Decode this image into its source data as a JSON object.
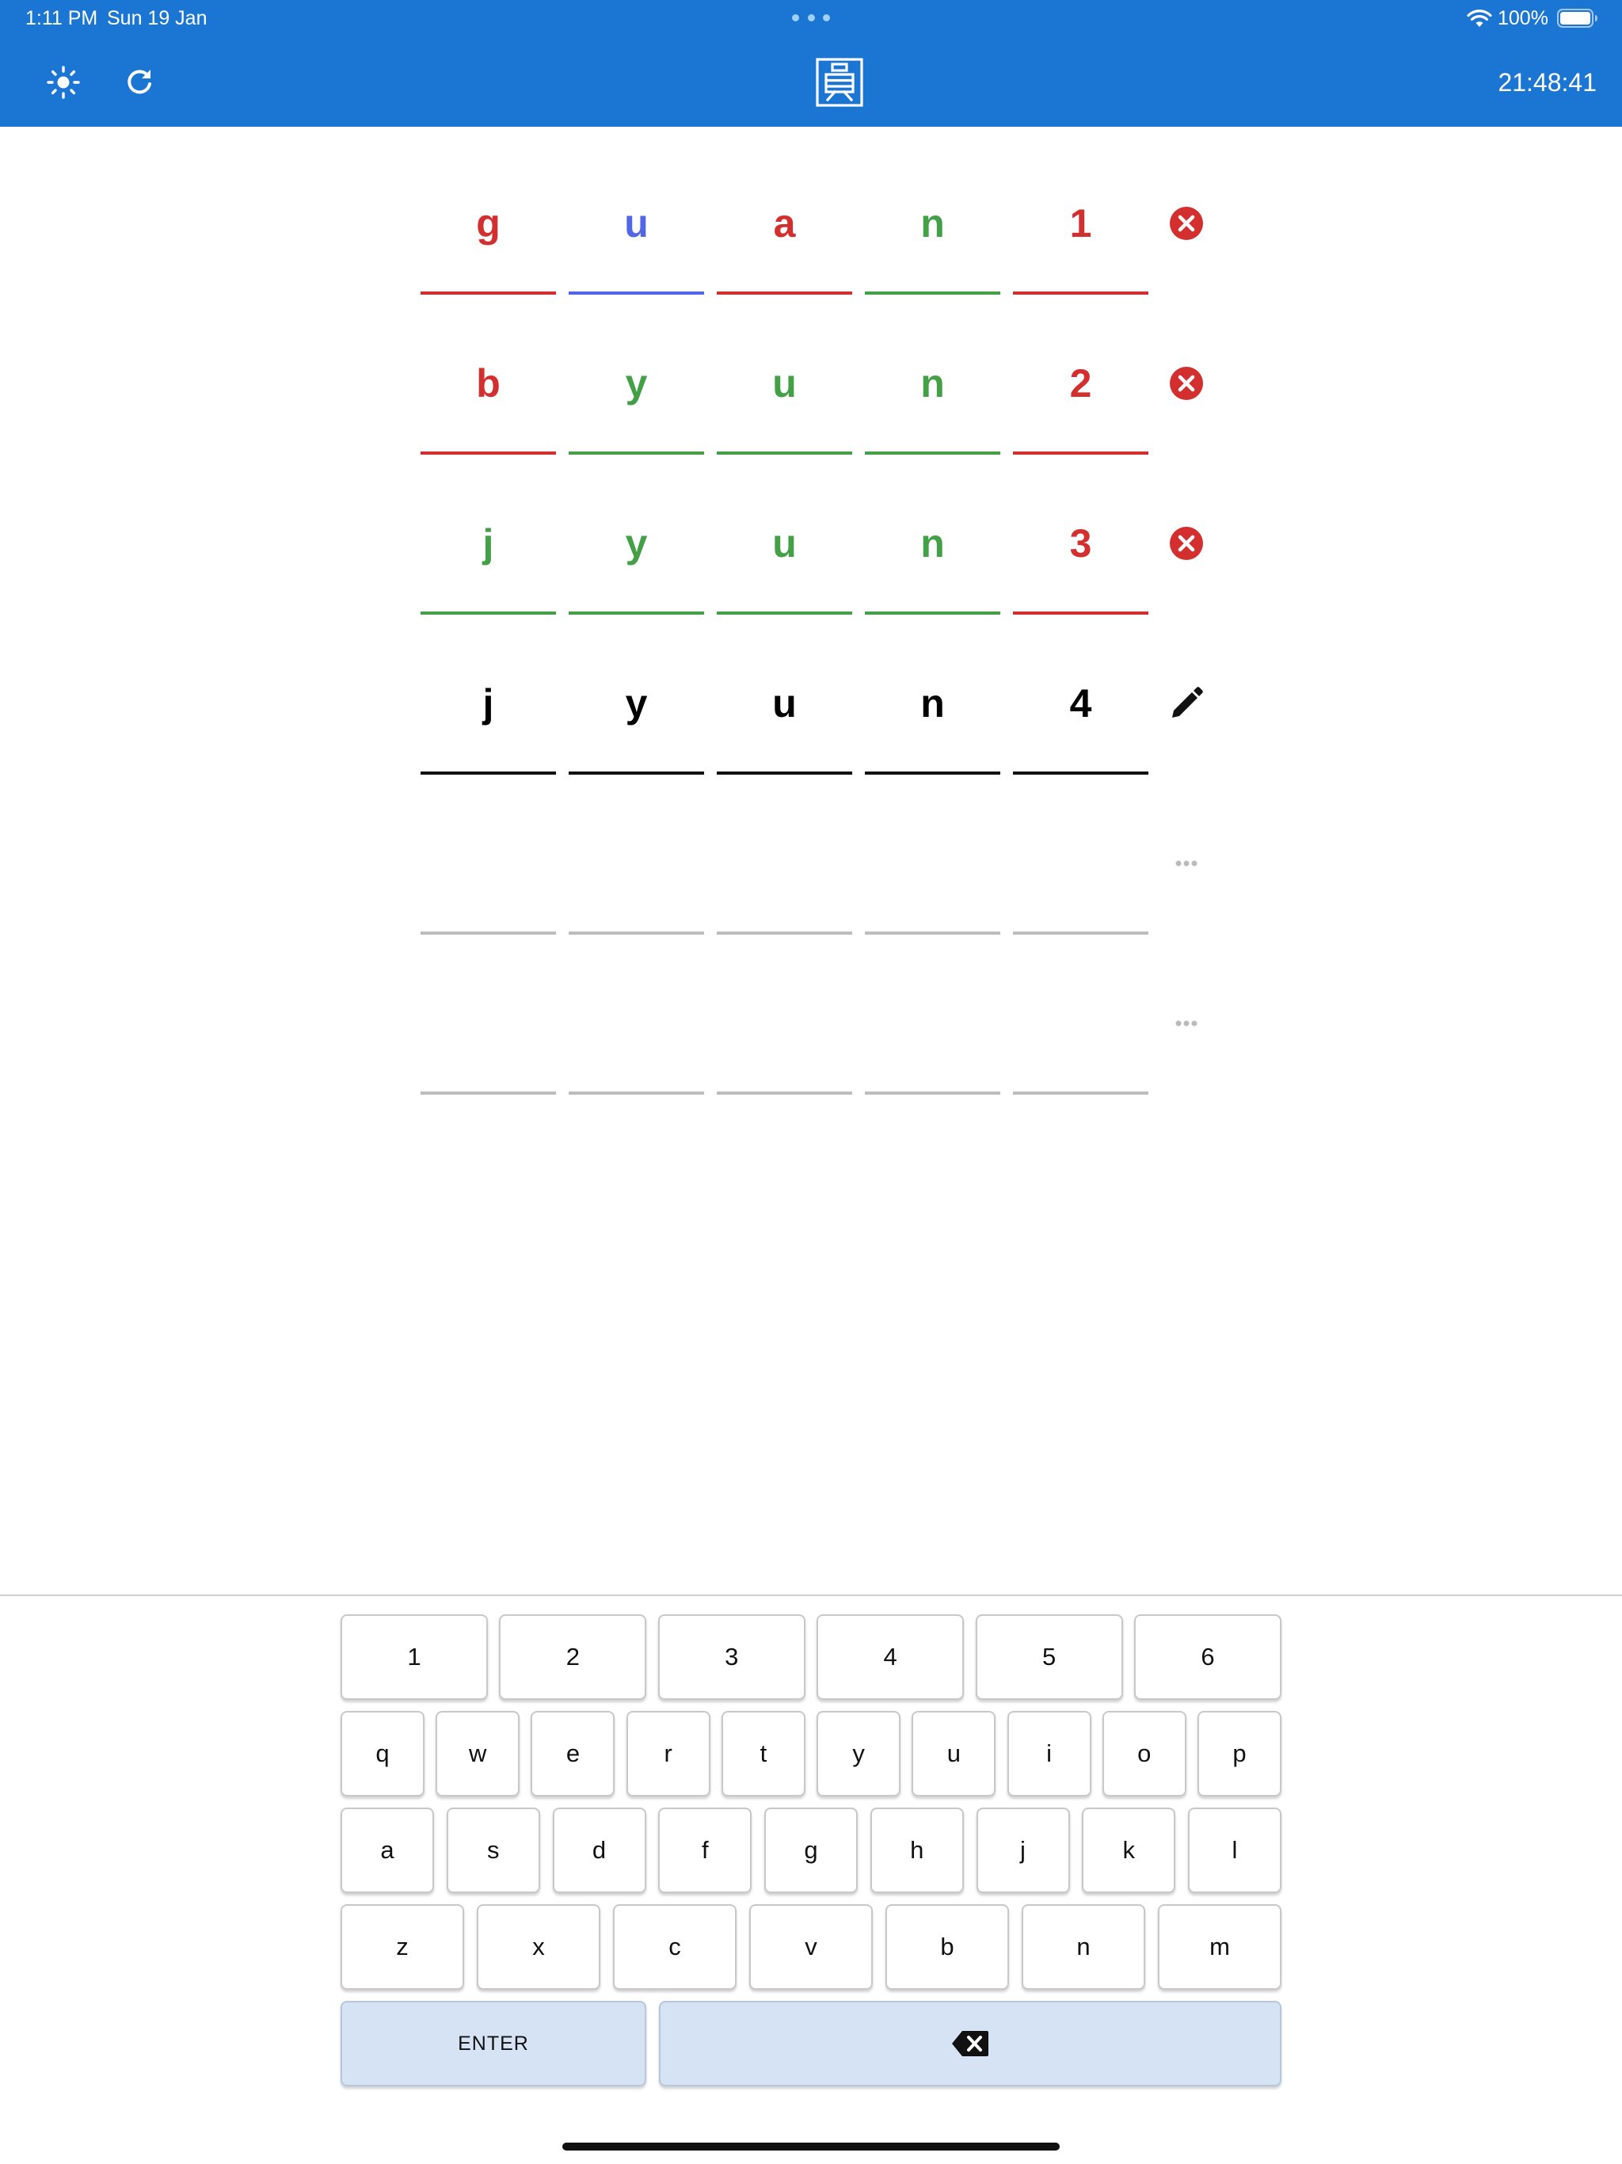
{
  "status_bar": {
    "time": "1:11 PM",
    "date": "Sun 19 Jan",
    "battery": "100%"
  },
  "app_bar": {
    "timer": "21:48:41",
    "logo_icon": "yuan-character-icon",
    "theme_icon": "sun-icon",
    "refresh_icon": "refresh-icon"
  },
  "colors": {
    "app_bar": "#1b76d3",
    "wrong": "#d32f2f",
    "misplaced": "#5068e8",
    "correct": "#43a047",
    "key_action": "#d6e3f5"
  },
  "board": {
    "rows": [
      {
        "cells": [
          {
            "letter": "g",
            "state": "red"
          },
          {
            "letter": "u",
            "state": "blue"
          },
          {
            "letter": "a",
            "state": "red"
          },
          {
            "letter": "n",
            "state": "green"
          },
          {
            "letter": "1",
            "state": "red"
          }
        ],
        "status_icon": "close-circle-icon"
      },
      {
        "cells": [
          {
            "letter": "b",
            "state": "red"
          },
          {
            "letter": "y",
            "state": "green"
          },
          {
            "letter": "u",
            "state": "green"
          },
          {
            "letter": "n",
            "state": "green"
          },
          {
            "letter": "2",
            "state": "red"
          }
        ],
        "status_icon": "close-circle-icon"
      },
      {
        "cells": [
          {
            "letter": "j",
            "state": "green"
          },
          {
            "letter": "y",
            "state": "green"
          },
          {
            "letter": "u",
            "state": "green"
          },
          {
            "letter": "n",
            "state": "green"
          },
          {
            "letter": "3",
            "state": "red"
          }
        ],
        "status_icon": "close-circle-icon"
      },
      {
        "cells": [
          {
            "letter": "j",
            "state": "current"
          },
          {
            "letter": "y",
            "state": "current"
          },
          {
            "letter": "u",
            "state": "current"
          },
          {
            "letter": "n",
            "state": "current"
          },
          {
            "letter": "4",
            "state": "current"
          }
        ],
        "status_icon": "pencil-icon"
      },
      {
        "cells": [
          {
            "letter": "",
            "state": "empty"
          },
          {
            "letter": "",
            "state": "empty"
          },
          {
            "letter": "",
            "state": "empty"
          },
          {
            "letter": "",
            "state": "empty"
          },
          {
            "letter": "",
            "state": "empty"
          }
        ],
        "status_icon": "more-horizontal-icon"
      },
      {
        "cells": [
          {
            "letter": "",
            "state": "empty"
          },
          {
            "letter": "",
            "state": "empty"
          },
          {
            "letter": "",
            "state": "empty"
          },
          {
            "letter": "",
            "state": "empty"
          },
          {
            "letter": "",
            "state": "empty"
          }
        ],
        "status_icon": "more-horizontal-icon"
      }
    ]
  },
  "keyboard": {
    "rows": [
      [
        "1",
        "2",
        "3",
        "4",
        "5",
        "6"
      ],
      [
        "q",
        "w",
        "e",
        "r",
        "t",
        "y",
        "u",
        "i",
        "o",
        "p"
      ],
      [
        "a",
        "s",
        "d",
        "f",
        "g",
        "h",
        "j",
        "k",
        "l"
      ],
      [
        "z",
        "x",
        "c",
        "v",
        "b",
        "n",
        "m"
      ]
    ],
    "enter_label": "ENTER",
    "backspace_icon": "backspace-icon"
  }
}
